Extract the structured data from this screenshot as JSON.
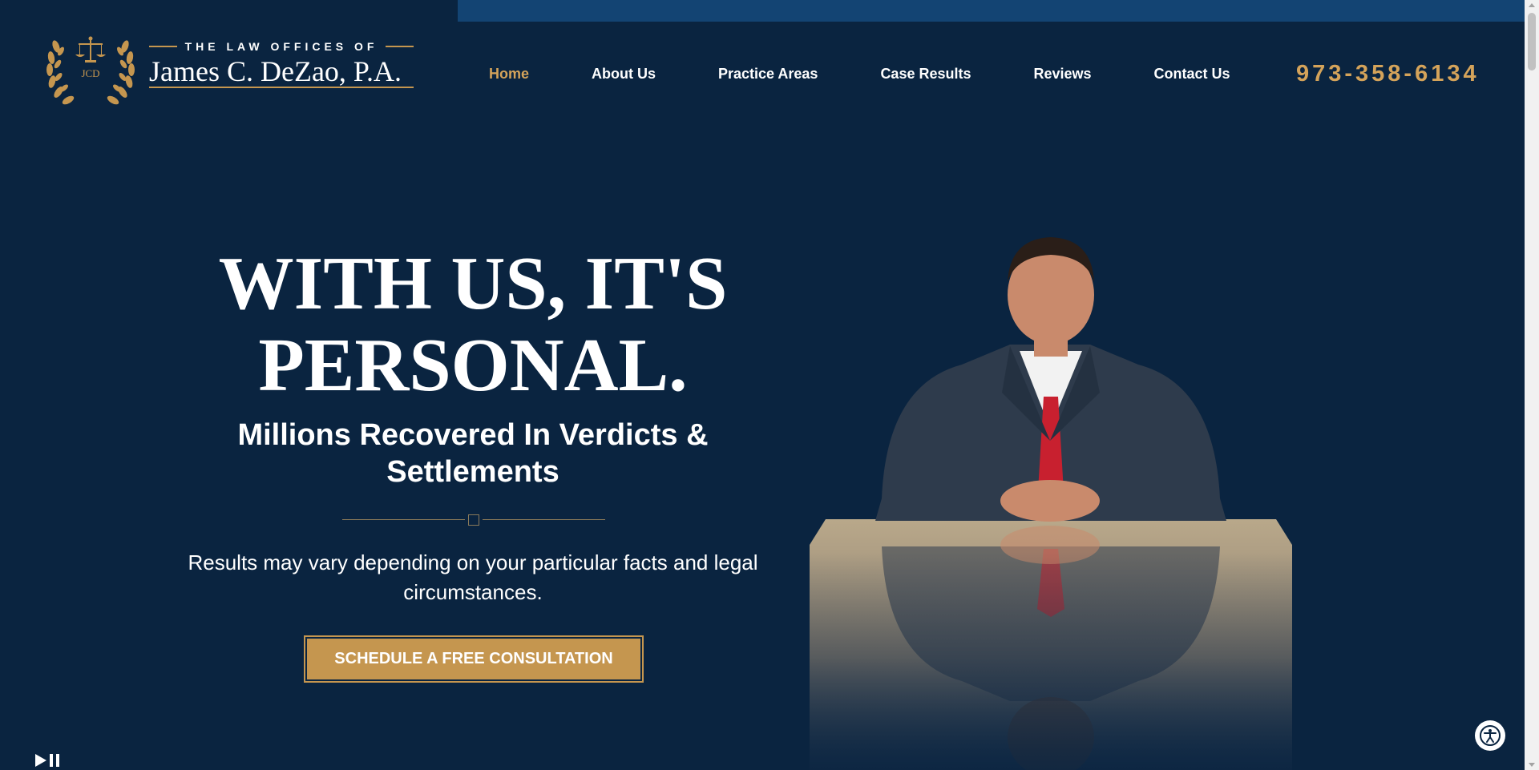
{
  "header": {
    "logo": {
      "monogram": "JCD",
      "pre_title": "THE LAW OFFICES OF",
      "name": "James C. DeZao, P.A."
    },
    "nav": [
      {
        "label": "Home",
        "active": true
      },
      {
        "label": "About Us",
        "active": false
      },
      {
        "label": "Practice Areas",
        "active": false
      },
      {
        "label": "Case Results",
        "active": false
      },
      {
        "label": "Reviews",
        "active": false
      },
      {
        "label": "Contact Us",
        "active": false
      }
    ],
    "phone": "973-358-6134"
  },
  "hero": {
    "title_line1": "With Us, It's",
    "title_line2": "Personal.",
    "subtitle": "Millions Recovered In Verdicts & Settlements",
    "disclaimer": "Results may vary depending on your particular facts and legal circumstances.",
    "cta_label": "SCHEDULE A FREE CONSULTATION"
  },
  "colors": {
    "background": "#0a2440",
    "top_strip": "#134473",
    "accent_gold": "#c5964f",
    "text": "#ffffff"
  },
  "icons": {
    "logo": "scales-of-justice-wreath-icon",
    "media_controls": [
      "play-icon",
      "pause-icon"
    ],
    "accessibility": "accessibility-icon"
  }
}
